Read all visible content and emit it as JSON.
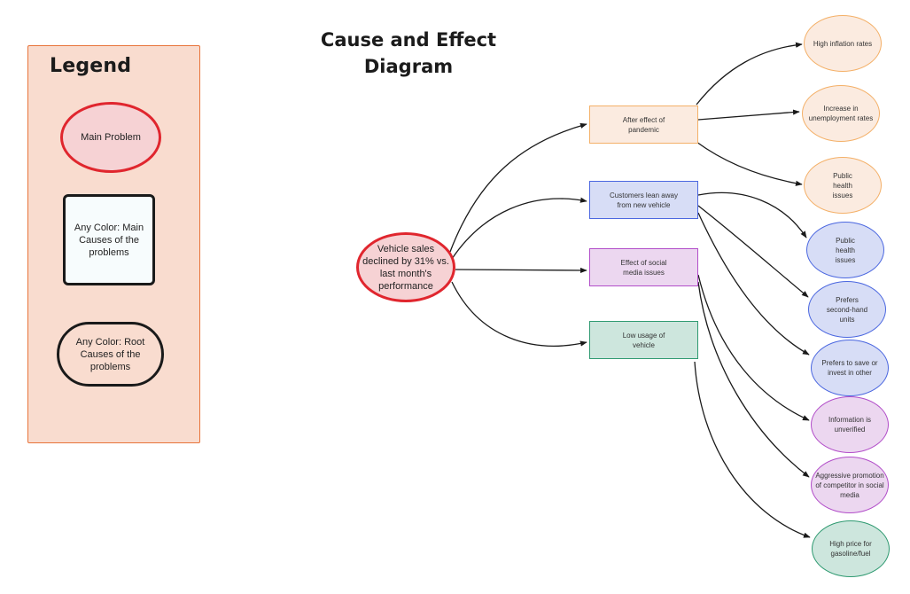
{
  "title": "Cause and Effect Diagram",
  "legend": {
    "title": "Legend",
    "main_problem": "Main Problem",
    "main_causes": "Any Color: Main Causes of the problems",
    "root_causes": "Any Color: Root Causes of the problems"
  },
  "colors": {
    "main_problem_border": "#e0262e",
    "main_problem_fill": "#f6d2d4",
    "legend_fill": "#f9dccf",
    "legend_border": "#e8743b",
    "orange_border": "#f4b068",
    "orange_fill": "#fbebe0",
    "blue_border": "#4b67e0",
    "blue_fill": "#d7ddf6",
    "purple_border": "#b24ec9",
    "purple_fill": "#ecd7f0",
    "green_border": "#2f9a71",
    "green_fill": "#cde6dd"
  },
  "main_problem": "Vehicle sales declined by 31% vs. last month's performance",
  "causes": [
    {
      "label": "After effect of pandemic",
      "color": "orange",
      "root_causes": [
        "High inflation rates",
        "Increase in unemployment rates",
        "Public health issues"
      ]
    },
    {
      "label": "Customers lean away from new vehicle",
      "color": "blue",
      "root_causes": [
        "Public health issues",
        "Prefers second-hand units",
        "Prefers to save or invest in other"
      ]
    },
    {
      "label": "Effect of social media issues",
      "color": "purple",
      "root_causes": [
        "Information is unverified",
        "Aggressive promotion of competitor in social media"
      ]
    },
    {
      "label": "Low usage of vehicle",
      "color": "green",
      "root_causes": [
        "High price for gasoline/fuel"
      ]
    }
  ]
}
